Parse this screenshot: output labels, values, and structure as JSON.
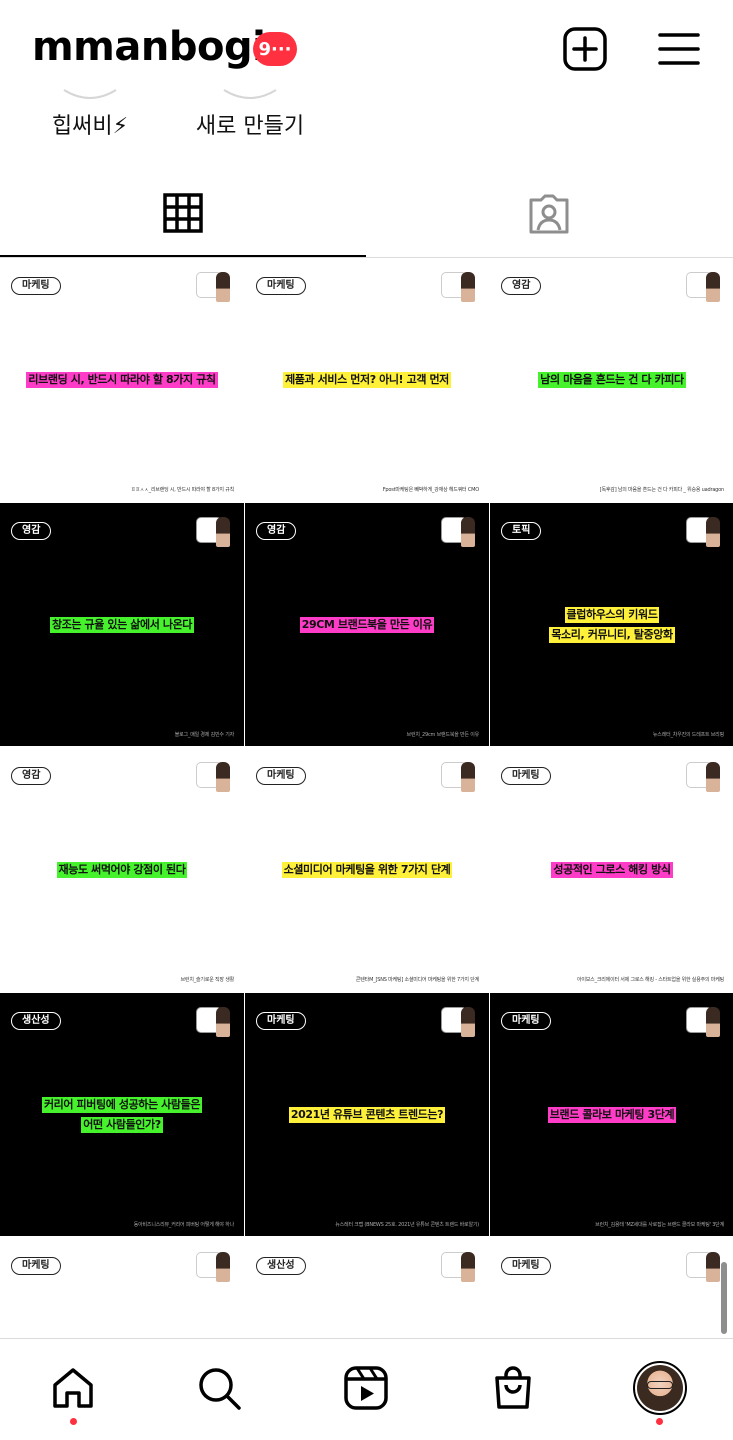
{
  "header": {
    "username": "mmanbogi",
    "notification_badge": "9···"
  },
  "highlights": [
    {
      "label": "힙써비⚡"
    },
    {
      "label": "새로 만들기"
    }
  ],
  "tabs": [
    {
      "name": "posts-grid",
      "icon": "grid-icon",
      "active": true
    },
    {
      "name": "tagged",
      "icon": "tagged-person-icon",
      "active": false
    }
  ],
  "posts": [
    {
      "theme": "white",
      "tag": "마케팅",
      "titles": [
        {
          "text": "리브랜딩 시, 반드시 따라야 할 8가지 규칙",
          "hl": "pink"
        }
      ],
      "source": "ㅍㅍㅅㅅ_리브랜딩 시, 반드시 따라야 할 8가지 규칙"
    },
    {
      "theme": "white",
      "tag": "마케팅",
      "titles": [
        {
          "text": "제품과 서비스 먼저? 아니! 고객 먼저",
          "hl": "yellow"
        }
      ],
      "source": "Fpost마케팅은 빼박하게_강재상 헤드쿼터 CMO"
    },
    {
      "theme": "white",
      "tag": "영감",
      "titles": [
        {
          "text": "남의 마음을 흔드는 건 다 카피다",
          "hl": "green"
        }
      ],
      "source": "[독후감] 남의 마음을 흔드는 건 다 카피다 _ 위승용 uadragon"
    },
    {
      "theme": "black",
      "tag": "영감",
      "titles": [
        {
          "text": "창조는 규율 있는 삶에서 나온다",
          "hl": "green"
        }
      ],
      "source": "블로그_매일 경제 김민수 기자"
    },
    {
      "theme": "black",
      "tag": "영감",
      "titles": [
        {
          "text": "29CM 브랜드북을 만든 이유",
          "hl": "pink"
        }
      ],
      "source": "브런치_29cm 브랜드북을 만든 이유"
    },
    {
      "theme": "black",
      "tag": "토픽",
      "titles": [
        {
          "text": "클럽하우스의 키워드",
          "hl": "yellow"
        },
        {
          "text": "목소리, 커뮤니티, 탈중앙화",
          "hl": "yellow"
        }
      ],
      "source": "뉴스레터_차우진의 드레프트 브리핑"
    },
    {
      "theme": "white",
      "tag": "영감",
      "titles": [
        {
          "text": "재능도 써먹어야 강점이 된다",
          "hl": "green"
        }
      ],
      "source": "브런치_슬기로운 직장 생활"
    },
    {
      "theme": "white",
      "tag": "마케팅",
      "titles": [
        {
          "text": "소셜미디어 마케팅을 위한 7가지 단계",
          "hl": "yellow"
        }
      ],
      "source": "콘텐타M_[SNS 마케팅] 소셜미디어 마케팅을 위한 7가지 단계"
    },
    {
      "theme": "white",
      "tag": "마케팅",
      "titles": [
        {
          "text": "성공적인 그로스 해킹 방식",
          "hl": "pink"
        }
      ],
      "source": "아이보스_크리에이터 서제 그로스 해킹 - 스타트업을 위한 실용주의 마케팅"
    },
    {
      "theme": "black",
      "tag": "생산성",
      "titles": [
        {
          "text": "커리어 피버팅에 성공하는 사람들은",
          "hl": "green"
        },
        {
          "text": "어떤 사람들인가?",
          "hl": "green"
        }
      ],
      "source": "동아비즈니스리뷰_커리어 피버팅 어떻게 해야 하나"
    },
    {
      "theme": "black",
      "tag": "마케팅",
      "titles": [
        {
          "text": "2021년 유튜브 콘텐츠 트렌드는?",
          "hl": "yellow"
        }
      ],
      "source": "뉴스레터 크랩 (BNEWS 25호. 2021년 유튜브 콘텐츠 트렌드 바로알기)"
    },
    {
      "theme": "black",
      "tag": "마케팅",
      "titles": [
        {
          "text": "브랜드 콜라보 마케팅 3단계",
          "hl": "pink"
        }
      ],
      "source": "브런치_김용태 'MZ세대를 사로잡는 브랜드 콜라보 마케팅' 3단계"
    },
    {
      "theme": "white",
      "tag": "마케팅",
      "titles": [],
      "source": ""
    },
    {
      "theme": "white",
      "tag": "생산성",
      "titles": [],
      "source": ""
    },
    {
      "theme": "white",
      "tag": "마케팅",
      "titles": [],
      "source": ""
    }
  ],
  "bottom_nav": [
    {
      "name": "home",
      "icon": "home-icon",
      "active": true
    },
    {
      "name": "search",
      "icon": "search-icon"
    },
    {
      "name": "reels",
      "icon": "reels-icon"
    },
    {
      "name": "shop",
      "icon": "shopping-bag-icon"
    },
    {
      "name": "profile",
      "icon": "profile-avatar",
      "has_dot": true
    }
  ],
  "colors": {
    "badge": "#ff3040",
    "highlight_pink": "#ff3cc7",
    "highlight_yellow": "#fff13a",
    "highlight_green": "#45f22b"
  }
}
